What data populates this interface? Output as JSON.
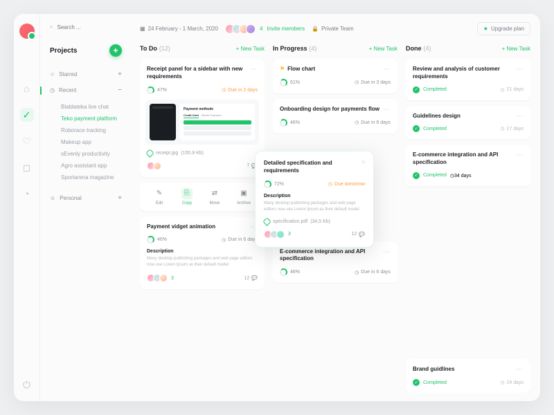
{
  "search": {
    "placeholder": "Search ..."
  },
  "sidebar": {
    "title": "Projects",
    "groups": {
      "starred": {
        "label": "Starred",
        "ex": "+"
      },
      "recent": {
        "label": "Recent",
        "ex": "−"
      },
      "personal": {
        "label": "Personal",
        "ex": "+"
      }
    },
    "projects": [
      {
        "label": "Blablateka live chat"
      },
      {
        "label": "Teko payment platform"
      },
      {
        "label": "Roborace tracking"
      },
      {
        "label": "Makeup app"
      },
      {
        "label": "sEvenly productivity"
      },
      {
        "label": "Agro assistant app"
      },
      {
        "label": "Sportarena magazine"
      }
    ]
  },
  "topbar": {
    "date": "24 February - 1 March, 2020",
    "member_count": "4",
    "invite": "Invite members",
    "private": "Private Team",
    "upgrade": "Upgrade plan"
  },
  "columns": {
    "todo": {
      "title": "To Do",
      "count": "(12)",
      "new": "+ New Task"
    },
    "progress": {
      "title": "In Progress",
      "count": "(4)",
      "new": "+ New Task"
    },
    "done": {
      "title": "Done",
      "count": "(4)",
      "new": "+ New Task"
    }
  },
  "cards": {
    "receipt": {
      "title": "Receipt panel for a sidebar with new requirements",
      "progress": "47%",
      "due": "Due in 2 days",
      "preview_title": "Payment methods",
      "tab1": "Credit Card",
      "tab2": "Mobile Payment",
      "attachment": "receipt.jpg",
      "attachment_size": "(155,9 Kb)",
      "comments": "7"
    },
    "widget": {
      "title": "Payment vidget animation",
      "progress": "46%",
      "due": "Due in 6 days",
      "desc_h": "Description",
      "desc_t": "Many desktop publishing packages and web page editors now use Lorem Ipsum as their default model",
      "count": "3",
      "comments": "12"
    },
    "flow": {
      "title": "Flow chart",
      "progress": "61%",
      "due": "Due in 3 days"
    },
    "onboard": {
      "title": "Onboarding design for payments flow",
      "progress": "46%",
      "due": "Due in 6 days"
    },
    "ecom": {
      "title": "E-commerce integration and API specification",
      "progress": "46%",
      "due": "Due in 6 days"
    },
    "review": {
      "title": "Review and analysis of customer requirements",
      "status": "Completed",
      "days": "21 days"
    },
    "guide": {
      "title": "Guidelines design",
      "status": "Completed",
      "days": "17 days"
    },
    "ecomd": {
      "title": "E-commerce integration and API specification",
      "status": "Completed",
      "days": "34 days"
    },
    "brand": {
      "title": "Brand guidlines",
      "status": "Completed",
      "days": "24 days"
    }
  },
  "popover": {
    "title": "Detailed specification and requirements",
    "progress": "72%",
    "due": "Due tomorrow",
    "desc_h": "Description",
    "desc_t": "Many desktop publishing packages and web page editors now use Lorem Ipsum as their default model",
    "attachment": "specification.pdf",
    "attachment_size": "(34,5 Kb)",
    "count": "3",
    "comments": "12"
  },
  "actions": {
    "edit": "Edit",
    "copy": "Copy",
    "move": "Move",
    "archive": "Archive"
  }
}
